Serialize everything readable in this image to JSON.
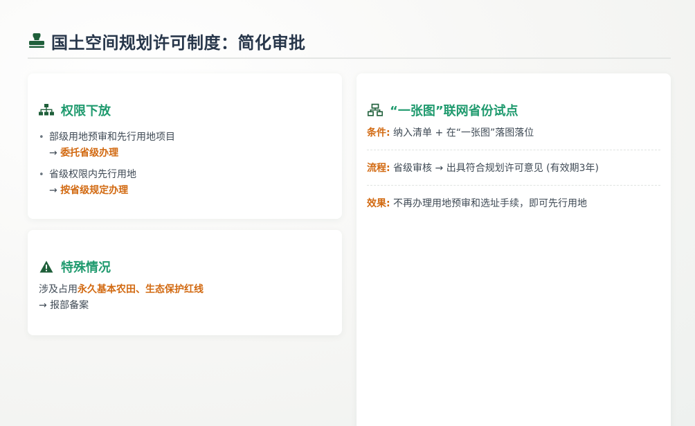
{
  "header": {
    "title": "国土空间规划许可制度：简化审批",
    "icon": "stamp-icon"
  },
  "card_authority": {
    "icon": "sitemap-icon",
    "title": "权限下放",
    "items": [
      {
        "text": "部级用地预审和先行用地项目",
        "arrow": "→ ",
        "highlight": "委托省级办理"
      },
      {
        "text": "省级权限内先行用地",
        "arrow": "→ ",
        "highlight": "按省级规定办理"
      }
    ]
  },
  "card_special": {
    "icon": "warning-icon",
    "title": "特殊情况",
    "prefix": "涉及占用",
    "hl1": "永久基本农田",
    "sep": "、",
    "hl2": "生态保护红线",
    "line2": "→ 报部备案"
  },
  "card_pilot": {
    "icon": "network-icon",
    "title": "“一张图”联网省份试点",
    "rows": [
      {
        "label": "条件:",
        "text": " 纳入清单 + 在“一张图”落图落位"
      },
      {
        "label": "流程:",
        "text": " 省级审核 → 出具符合规划许可意见 (有效期3年)"
      },
      {
        "label": "效果:",
        "text": " 不再办理用地预审和选址手续，即可先行用地"
      }
    ]
  },
  "colors": {
    "accent_green": "#1f9a6e",
    "icon_green": "#1f5f3a",
    "highlight_orange": "#d26a12",
    "title_navy": "#27364a"
  }
}
